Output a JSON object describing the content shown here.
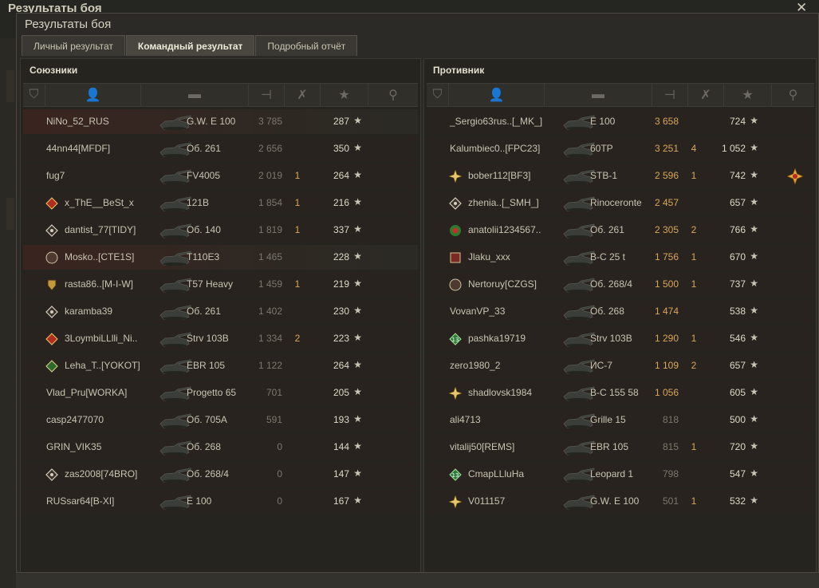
{
  "background_window": {
    "title": "Результаты боя",
    "close_glyph": "✕"
  },
  "dialog": {
    "title": "Результаты боя",
    "close_glyph": "✕"
  },
  "tabs": [
    {
      "label": "Личный результат",
      "active": false
    },
    {
      "label": "Командный результат",
      "active": true
    },
    {
      "label": "Подробный отчёт",
      "active": false
    }
  ],
  "allies": {
    "title": "Союзники",
    "columns": [
      "squad-icon",
      "player-icon",
      "tank-icon",
      "damage-icon",
      "kills-icon",
      "xp-star-icon",
      "medal-icon"
    ],
    "rows": [
      {
        "player": "NiNo_52_RUS",
        "badge": "",
        "tank": "G.W. E 100",
        "damage": "3 785",
        "kills": "",
        "xp": "287",
        "highlight": "glow"
      },
      {
        "player": "44nn44[MFDF]",
        "badge": "",
        "tank": "Об. 261",
        "damage": "2 656",
        "kills": "",
        "xp": "350",
        "highlight": "dark"
      },
      {
        "player": "fug7",
        "badge": "",
        "tank": "FV4005",
        "damage": "2 019",
        "kills": "1",
        "xp": "264",
        "highlight": "dark"
      },
      {
        "player": "x_ThE__BeSt_x",
        "badge": "clan-badge-red",
        "tank": "121B",
        "damage": "1 854",
        "kills": "1",
        "xp": "216",
        "highlight": "dark"
      },
      {
        "player": "dantist_77[TIDY]",
        "badge": "clan-badge-diamond",
        "tank": "Об. 140",
        "damage": "1 819",
        "kills": "1",
        "xp": "337",
        "highlight": "dark"
      },
      {
        "player": "Mosko..[CTE1S]",
        "badge": "clan-badge-round",
        "tank": "T110E3",
        "damage": "1 465",
        "kills": "",
        "xp": "228",
        "highlight": "glow"
      },
      {
        "player": "rasta86..[M-I-W]",
        "badge": "clan-badge-shield",
        "tank": "T57 Heavy",
        "damage": "1 459",
        "kills": "1",
        "xp": "219",
        "highlight": "dark"
      },
      {
        "player": "karamba39",
        "badge": "clan-badge-diamond",
        "tank": "Об. 261",
        "damage": "1 402",
        "kills": "",
        "xp": "230",
        "highlight": "dark"
      },
      {
        "player": "3LoymbiLLlli_Ni..",
        "badge": "clan-badge-red",
        "tank": "Strv 103B",
        "damage": "1 334",
        "kills": "2",
        "xp": "223",
        "highlight": "dark"
      },
      {
        "player": "Leha_T..[YOKOT]",
        "badge": "clan-badge-green",
        "tank": "EBR 105",
        "damage": "1 122",
        "kills": "",
        "xp": "264",
        "highlight": "dark"
      },
      {
        "player": "Vlad_Pru[WORKA]",
        "badge": "",
        "tank": "Progetto 65",
        "damage": "701",
        "kills": "",
        "xp": "205",
        "highlight": "dark"
      },
      {
        "player": "casp2477070",
        "badge": "",
        "tank": "Об. 705А",
        "damage": "591",
        "kills": "",
        "xp": "193",
        "highlight": "dark"
      },
      {
        "player": "GRIN_VIK35",
        "badge": "",
        "tank": "Об. 268",
        "damage": "0",
        "kills": "",
        "xp": "144",
        "highlight": "dark"
      },
      {
        "player": "zas2008[74BRO]",
        "badge": "clan-badge-diamond",
        "tank": "Об. 268/4",
        "damage": "0",
        "kills": "",
        "xp": "147",
        "highlight": "dark"
      },
      {
        "player": "RUSsar64[B-XI]",
        "badge": "",
        "tank": "E 100",
        "damage": "0",
        "kills": "",
        "xp": "167",
        "highlight": "dark"
      }
    ]
  },
  "enemies": {
    "title": "Противник",
    "rows": [
      {
        "player": "_Sergio63rus..[_MK_]",
        "badge": "",
        "tank": "E 100",
        "damage": "3 658",
        "kills": "",
        "xp": "724",
        "medal": false
      },
      {
        "player": "Kalumbiec0..[FPC23]",
        "badge": "",
        "tank": "60TP",
        "damage": "3 251",
        "kills": "4",
        "xp": "1 052",
        "medal": false
      },
      {
        "player": "bober112[BF3]",
        "badge": "clan-badge-star",
        "tank": "STB-1",
        "damage": "2 596",
        "kills": "1",
        "xp": "742",
        "medal": true
      },
      {
        "player": "zhenia..[_SMH_]",
        "badge": "clan-badge-diamond",
        "tank": "Rinoceronte",
        "damage": "2 457",
        "kills": "",
        "xp": "657",
        "medal": false
      },
      {
        "player": "anatolii1234567..",
        "badge": "clan-badge-green-red",
        "tank": "Об. 261",
        "damage": "2 305",
        "kills": "2",
        "xp": "766",
        "medal": false
      },
      {
        "player": "Jlaku_xxx",
        "badge": "clan-badge-square",
        "tank": "В-С 25 t",
        "damage": "1 756",
        "kills": "1",
        "xp": "670",
        "medal": false
      },
      {
        "player": "Nertoruy[CZGS]",
        "badge": "clan-badge-round",
        "tank": "Об. 268/4",
        "damage": "1 500",
        "kills": "1",
        "xp": "737",
        "medal": false
      },
      {
        "player": "VovanVP_33",
        "badge": "",
        "tank": "Об. 268",
        "damage": "1 474",
        "kills": "",
        "xp": "538",
        "medal": false
      },
      {
        "player": "pashka19719",
        "badge": "clan-badge-13",
        "tank": "Strv 103B",
        "damage": "1 290",
        "kills": "1",
        "xp": "546",
        "medal": false
      },
      {
        "player": "zero1980_2",
        "badge": "",
        "tank": "ИС-7",
        "damage": "1 109",
        "kills": "2",
        "xp": "657",
        "medal": false
      },
      {
        "player": "shadlovsk1984",
        "badge": "clan-badge-star",
        "tank": "В-С 155 58",
        "damage": "1 056",
        "kills": "",
        "xp": "605",
        "medal": false
      },
      {
        "player": "ali4713",
        "badge": "",
        "tank": "Grille 15",
        "damage": "818",
        "kills": "",
        "xp": "500",
        "medal": false
      },
      {
        "player": "vitalij50[REMS]",
        "badge": "",
        "tank": "EBR 105",
        "damage": "815",
        "kills": "1",
        "xp": "720",
        "medal": false
      },
      {
        "player": "CmapLLluHa",
        "badge": "clan-badge-13",
        "tank": "Leopard 1",
        "damage": "798",
        "kills": "",
        "xp": "547",
        "medal": false
      },
      {
        "player": "V011157",
        "badge": "clan-badge-star",
        "tank": "G.W. E 100",
        "damage": "501",
        "kills": "1",
        "xp": "532",
        "medal": false
      }
    ]
  },
  "colors": {
    "gold": "#d8a659",
    "dim": "#7b786e",
    "name": "#c8c4b2"
  }
}
